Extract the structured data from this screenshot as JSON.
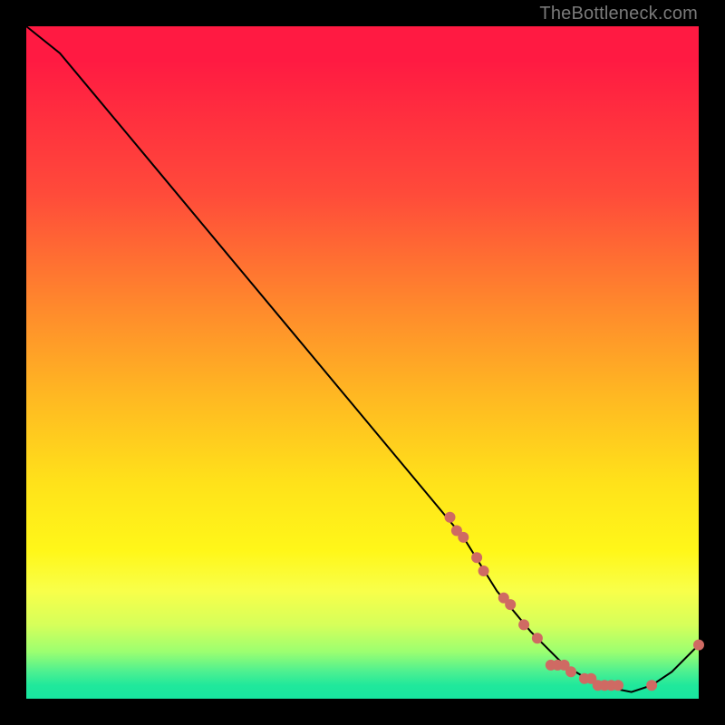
{
  "credit": "TheBottleneck.com",
  "chart_data": {
    "type": "line",
    "title": "",
    "xlabel": "",
    "ylabel": "",
    "xlim": [
      0,
      100
    ],
    "ylim": [
      0,
      100
    ],
    "grid": false,
    "series": [
      {
        "name": "curve",
        "color": "#000000",
        "points": [
          {
            "x": 0,
            "y": 100
          },
          {
            "x": 5,
            "y": 96
          },
          {
            "x": 10,
            "y": 90
          },
          {
            "x": 20,
            "y": 78
          },
          {
            "x": 30,
            "y": 66
          },
          {
            "x": 40,
            "y": 54
          },
          {
            "x": 50,
            "y": 42
          },
          {
            "x": 60,
            "y": 30
          },
          {
            "x": 65,
            "y": 24
          },
          {
            "x": 70,
            "y": 16
          },
          {
            "x": 75,
            "y": 10
          },
          {
            "x": 80,
            "y": 5
          },
          {
            "x": 85,
            "y": 2
          },
          {
            "x": 90,
            "y": 1
          },
          {
            "x": 93,
            "y": 2
          },
          {
            "x": 96,
            "y": 4
          },
          {
            "x": 100,
            "y": 8
          }
        ]
      }
    ],
    "markers": {
      "name": "dots",
      "color": "#cf6a63",
      "radius": 6,
      "points": [
        {
          "x": 63,
          "y": 27
        },
        {
          "x": 64,
          "y": 25
        },
        {
          "x": 65,
          "y": 24
        },
        {
          "x": 67,
          "y": 21
        },
        {
          "x": 68,
          "y": 19
        },
        {
          "x": 71,
          "y": 15
        },
        {
          "x": 72,
          "y": 14
        },
        {
          "x": 74,
          "y": 11
        },
        {
          "x": 76,
          "y": 9
        },
        {
          "x": 78,
          "y": 5
        },
        {
          "x": 79,
          "y": 5
        },
        {
          "x": 80,
          "y": 5
        },
        {
          "x": 81,
          "y": 4
        },
        {
          "x": 83,
          "y": 3
        },
        {
          "x": 84,
          "y": 3
        },
        {
          "x": 85,
          "y": 2
        },
        {
          "x": 86,
          "y": 2
        },
        {
          "x": 87,
          "y": 2
        },
        {
          "x": 88,
          "y": 2
        },
        {
          "x": 93,
          "y": 2
        },
        {
          "x": 100,
          "y": 8
        }
      ]
    }
  }
}
